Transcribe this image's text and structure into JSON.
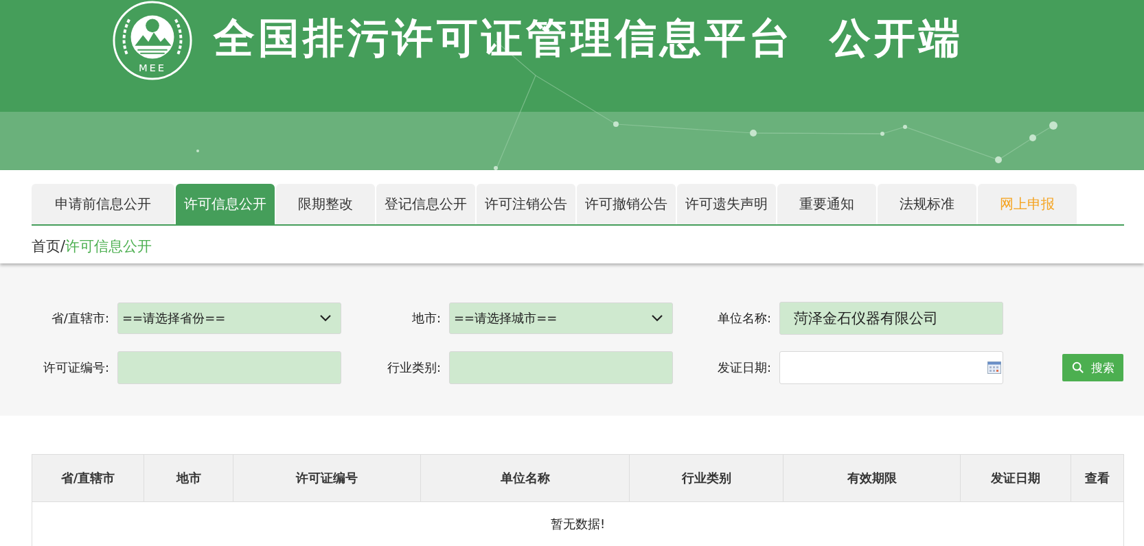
{
  "header": {
    "logo_text": "MEE",
    "title": "全国排污许可证管理信息平台  公开端"
  },
  "tabs": [
    {
      "label": "申请前信息公开",
      "selected": false,
      "accent": false
    },
    {
      "label": "许可信息公开",
      "selected": true,
      "accent": false
    },
    {
      "label": "限期整改",
      "selected": false,
      "accent": false
    },
    {
      "label": "登记信息公开",
      "selected": false,
      "accent": false
    },
    {
      "label": "许可注销公告",
      "selected": false,
      "accent": false
    },
    {
      "label": "许可撤销公告",
      "selected": false,
      "accent": false
    },
    {
      "label": "许可遗失声明",
      "selected": false,
      "accent": false
    },
    {
      "label": "重要通知",
      "selected": false,
      "accent": false
    },
    {
      "label": "法规标准",
      "selected": false,
      "accent": false
    },
    {
      "label": "网上申报",
      "selected": false,
      "accent": true
    }
  ],
  "breadcrumb": {
    "home": "首页",
    "separator": "/",
    "current": "许可信息公开"
  },
  "filters": [
    {
      "label": "省/直辖市:",
      "kind": "select",
      "value": "==请选择省份=="
    },
    {
      "label": "地市:",
      "kind": "select",
      "value": "==请选择城市=="
    },
    {
      "label": "单位名称:",
      "kind": "text",
      "value": "菏泽金石仪器有限公司"
    },
    {
      "label": "许可证编号:",
      "kind": "text"
    },
    {
      "label": "行业类别:",
      "kind": "text"
    },
    {
      "label": "发证日期:",
      "kind": "date"
    }
  ],
  "search_button": {
    "label": "搜索"
  },
  "table": {
    "columns": [
      "省/直辖市",
      "地市",
      "许可证编号",
      "单位名称",
      "行业类别",
      "有效期限",
      "发证日期",
      "查看"
    ],
    "empty_message": "暂无数据!"
  }
}
